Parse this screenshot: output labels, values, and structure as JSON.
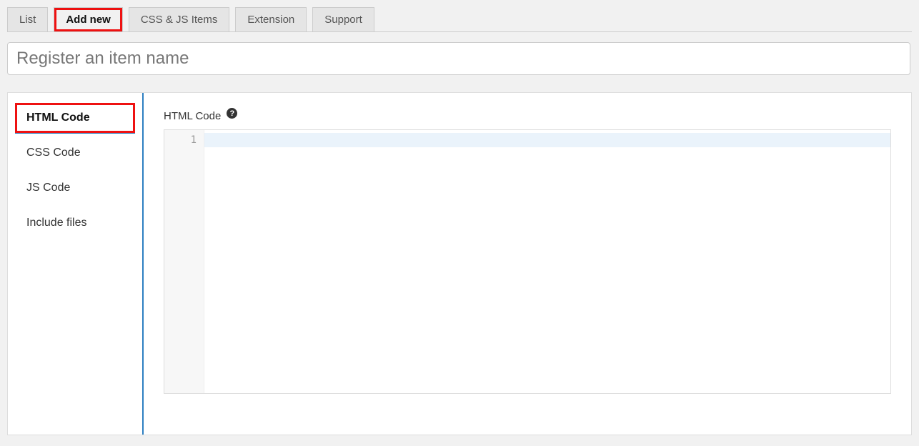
{
  "tabs": [
    {
      "label": "List"
    },
    {
      "label": "Add new",
      "active": true,
      "highlight": true
    },
    {
      "label": "CSS & JS Items"
    },
    {
      "label": "Extension"
    },
    {
      "label": "Support"
    }
  ],
  "title_input": {
    "placeholder": "Register an item name",
    "value": ""
  },
  "sidebar": {
    "items": [
      {
        "label": "HTML Code",
        "active": true,
        "highlight": true
      },
      {
        "label": "CSS Code"
      },
      {
        "label": "JS Code"
      },
      {
        "label": "Include files"
      }
    ]
  },
  "editor": {
    "label": "HTML Code",
    "help_glyph": "?",
    "line_numbers": [
      "1"
    ],
    "content_lines": [
      ""
    ]
  }
}
